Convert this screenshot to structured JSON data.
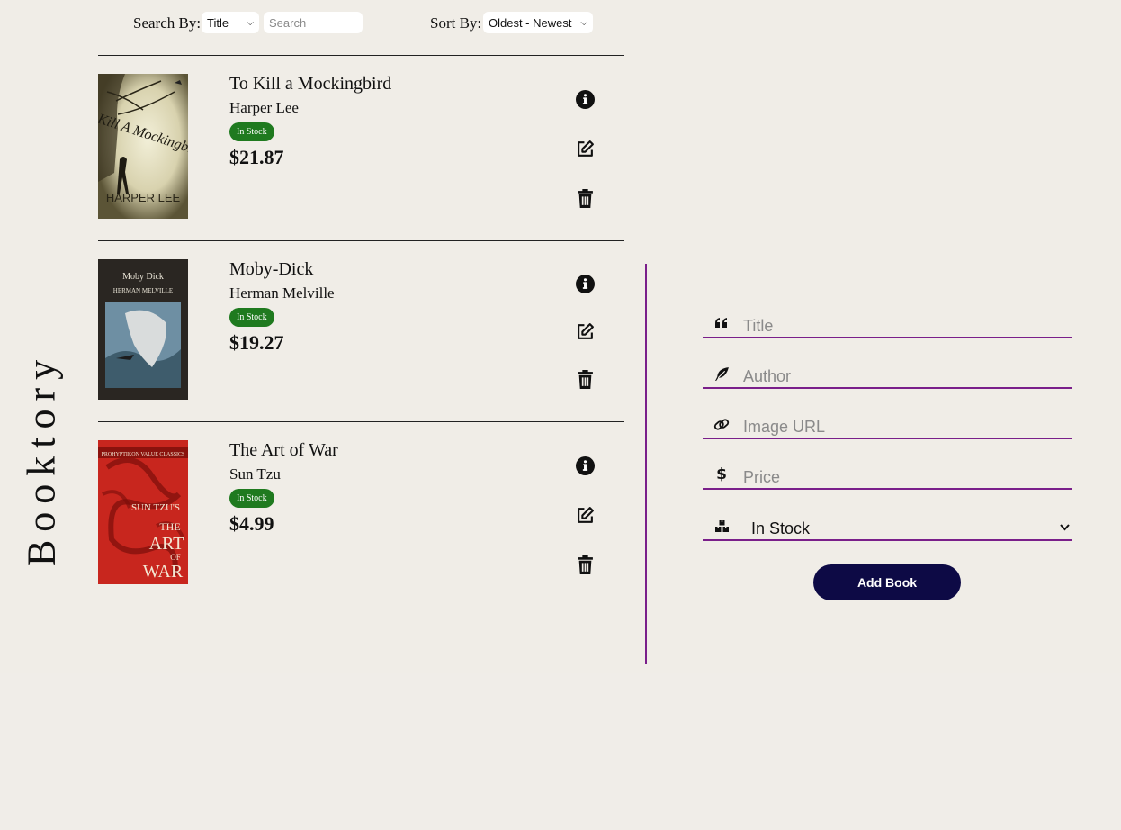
{
  "app": {
    "brand": "Booktory"
  },
  "toolbar": {
    "search_by_label": "Search By:",
    "search_by_value": "Title",
    "search_placeholder": "Search",
    "sort_by_label": "Sort By:",
    "sort_by_value": "Oldest - Newest"
  },
  "books": [
    {
      "title": "To Kill a Mockingbird",
      "author": "Harper Lee",
      "stock": "In Stock",
      "price": "$21.87"
    },
    {
      "title": "Moby-Dick",
      "author": "Herman Melville",
      "stock": "In Stock",
      "price": "$19.27"
    },
    {
      "title": "The Art of War",
      "author": "Sun Tzu",
      "stock": "In Stock",
      "price": "$4.99"
    }
  ],
  "covers": {
    "mockingbird_text": "To Kill A Mockingbird",
    "mockingbird_author": "HARPER LEE",
    "moby_title": "Moby Dick",
    "moby_author": "HERMAN MELVILLE",
    "artofwar_series": "PROHYPTIKON VALUE CLASSICS",
    "artofwar_l1": "SUN TZU'S",
    "artofwar_l2": "THE",
    "artofwar_l3": "ART",
    "artofwar_l4": "OF",
    "artofwar_l5": "WAR"
  },
  "form": {
    "title_placeholder": "Title",
    "author_placeholder": "Author",
    "image_placeholder": "Image URL",
    "price_placeholder": "Price",
    "stock_value": "In Stock",
    "submit_label": "Add Book"
  },
  "colors": {
    "accent": "#7a1f8a",
    "button": "#0d0a45",
    "badge": "#1f7a1f",
    "background": "#f0ede7"
  },
  "icons": [
    "info-icon",
    "edit-icon",
    "trash-icon",
    "quote-icon",
    "feather-icon",
    "link-icon",
    "dollar-icon",
    "boxes-icon",
    "chevron-down-icon"
  ]
}
